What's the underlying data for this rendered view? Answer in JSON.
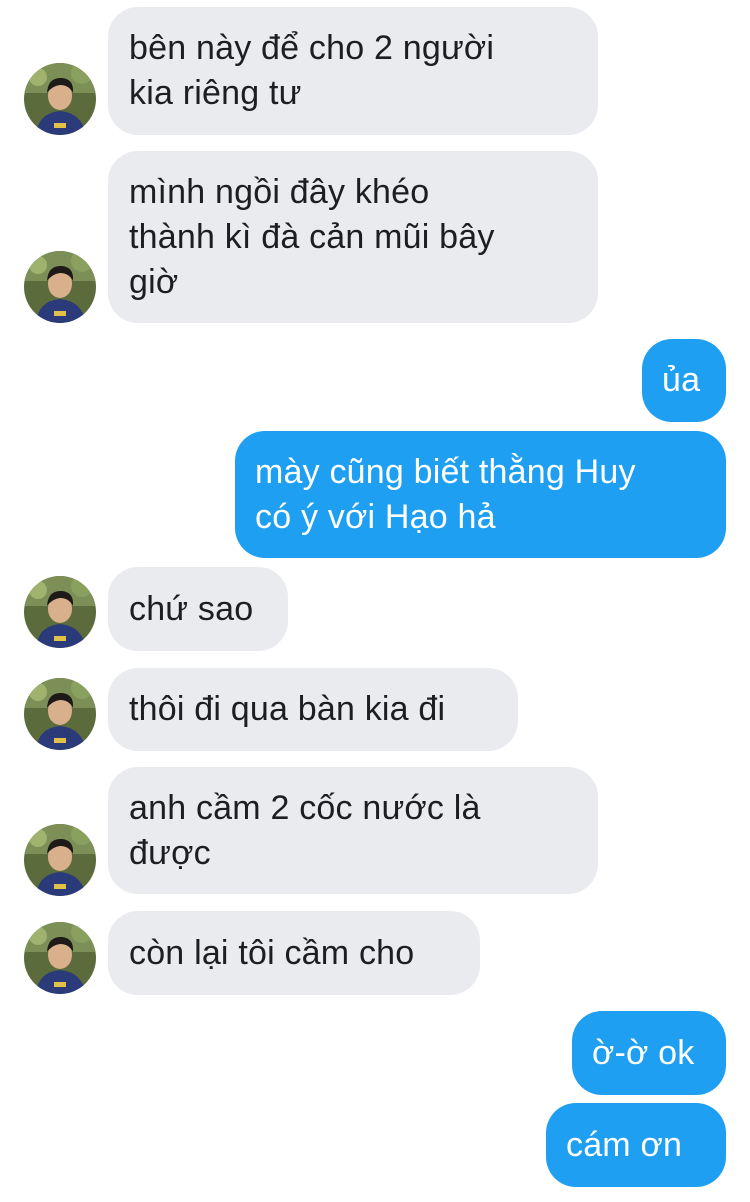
{
  "thread": {
    "messages": [
      {
        "direction": "incoming",
        "text": "bên này để cho 2 người\nkia riêng tư",
        "avatar": "contact-avatar"
      },
      {
        "direction": "incoming",
        "text": "mình ngồi đây khéo\nthành kì đà cản mũi bây\ngiờ",
        "avatar": "contact-avatar"
      },
      {
        "direction": "outgoing",
        "text": "ủa"
      },
      {
        "direction": "outgoing",
        "text": "mày cũng biết thằng Huy\ncó ý với Hạo hả"
      },
      {
        "direction": "incoming",
        "text": "chứ sao",
        "avatar": "contact-avatar"
      },
      {
        "direction": "incoming",
        "text": "thôi đi qua bàn kia đi",
        "avatar": "contact-avatar"
      },
      {
        "direction": "incoming",
        "text": "anh cầm 2 cốc nước là\nđược",
        "avatar": "contact-avatar"
      },
      {
        "direction": "incoming",
        "text": "còn lại tôi cầm cho",
        "avatar": "contact-avatar"
      },
      {
        "direction": "outgoing",
        "text": "ờ-ờ ok"
      },
      {
        "direction": "outgoing",
        "text": "cám ơn"
      }
    ]
  },
  "colors": {
    "incoming_bubble": "#e9ebee",
    "incoming_text": "#1c1e21",
    "outgoing_bubble": "#1e9ff2",
    "outgoing_text": "#ffffff",
    "background": "#ffffff"
  }
}
